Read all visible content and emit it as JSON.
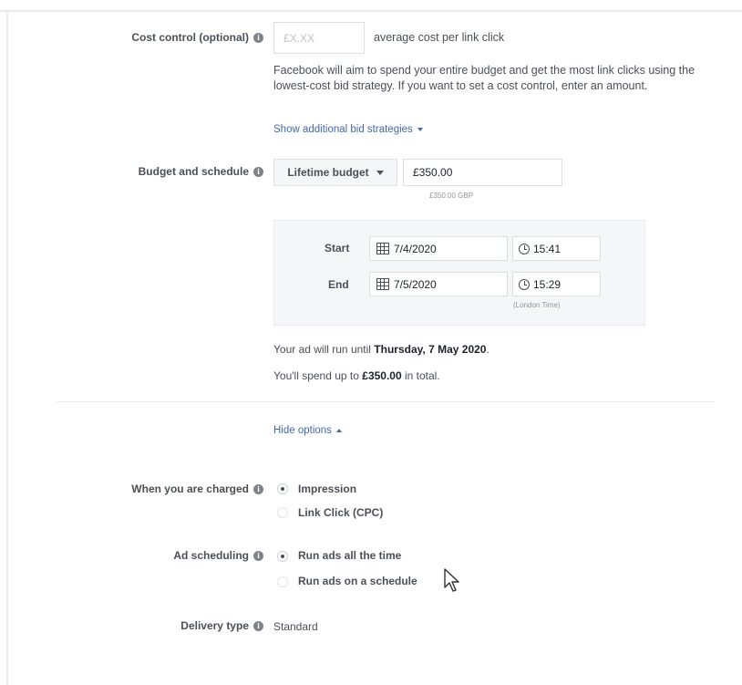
{
  "cost_control": {
    "label": "Cost control (optional)",
    "placeholder": "£X.XX",
    "suffix": "average cost per link click",
    "description": "Facebook will aim to spend your entire budget and get the most link clicks using the lowest-cost bid strategy. If you want to set a cost control, enter an amount.",
    "link": "Show additional bid strategies"
  },
  "budget": {
    "label": "Budget and schedule",
    "type": "Lifetime budget",
    "amount": "£350.00",
    "amount_note": "£350.00 GBP",
    "start_label": "Start",
    "start_date": "7/4/2020",
    "start_time": "15:41",
    "end_label": "End",
    "end_date": "7/5/2020",
    "end_time": "15:29",
    "timezone": "(London Time)",
    "run_prefix": "Your ad will run until ",
    "run_date": "Thursday, 7 May 2020",
    "run_suffix": ".",
    "spend_prefix": "You'll spend up to ",
    "spend_amount": "£350.00",
    "spend_suffix": " in total."
  },
  "hide_options": "Hide options",
  "charged": {
    "label": "When you are charged",
    "options": [
      "Impression",
      "Link Click (CPC)"
    ],
    "selected": "Impression"
  },
  "ad_scheduling": {
    "label": "Ad scheduling",
    "options": [
      "Run ads all the time",
      "Run ads on a schedule"
    ],
    "selected": "Run ads all the time"
  },
  "delivery": {
    "label": "Delivery type",
    "value": "Standard"
  },
  "colors": {
    "link": "#4267b2",
    "text": "#4b4f56",
    "border": "#dddfe2"
  }
}
